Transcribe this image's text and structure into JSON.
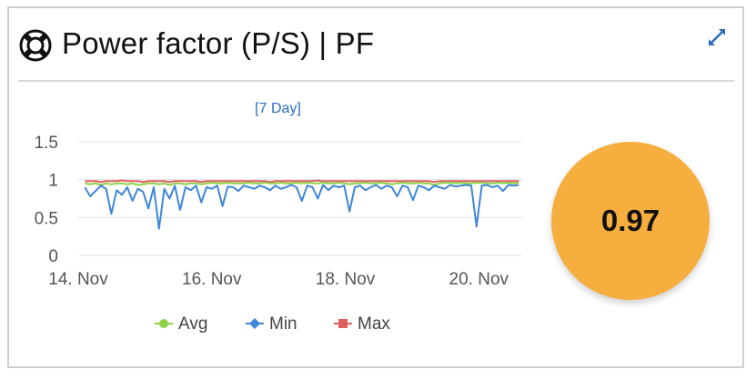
{
  "header": {
    "title": "Power factor (P/S) | PF",
    "icon": "lifebuoy-icon",
    "expand_icon": "expand-icon"
  },
  "chart": {
    "range_label": "[7 Day]",
    "legend": [
      {
        "name": "Avg",
        "color": "#8cd24b",
        "symbol": "circle"
      },
      {
        "name": "Min",
        "color": "#3f86d8",
        "symbol": "diamond"
      },
      {
        "name": "Max",
        "color": "#e06060",
        "symbol": "square"
      }
    ]
  },
  "chart_data": {
    "type": "line",
    "title": "[7 Day]",
    "xlabel": "",
    "ylabel": "",
    "ylim": [
      0,
      1.5
    ],
    "yticks": [
      "0",
      "0.5",
      "1",
      "1.5"
    ],
    "xticks": [
      "14. Nov",
      "16. Nov",
      "18. Nov",
      "20. Nov"
    ],
    "xtick_values": [
      14,
      16,
      18,
      20
    ],
    "xlim": [
      14,
      20.65
    ],
    "grid": true,
    "legend_position": "bottom",
    "series": [
      {
        "name": "Max",
        "color": "#e06060",
        "values": [
          0.98,
          0.98,
          0.98,
          0.97,
          0.98,
          0.98,
          0.98,
          0.99,
          0.98,
          0.98,
          0.98,
          0.97,
          0.98,
          0.98,
          0.98,
          0.98,
          0.97,
          0.98,
          0.98,
          0.98,
          0.98,
          0.98,
          0.97,
          0.98,
          0.98,
          0.98,
          0.98,
          0.98,
          0.98,
          0.98,
          0.98,
          0.98,
          0.98,
          0.98,
          0.98,
          0.97,
          0.98,
          0.98,
          0.98,
          0.98,
          0.98,
          0.98,
          0.98,
          0.98,
          0.99,
          0.98,
          0.98,
          0.98,
          0.98,
          0.98,
          0.98,
          0.98,
          0.98,
          0.98,
          0.98,
          0.98,
          0.98,
          0.98,
          0.98,
          0.98,
          0.98,
          0.98,
          0.98,
          0.98,
          0.98,
          0.98,
          0.97,
          0.98,
          0.98,
          0.98,
          0.98,
          0.98,
          0.98,
          0.98,
          0.98,
          0.98,
          0.98,
          0.98,
          0.98,
          0.98,
          0.98,
          0.98,
          0.98
        ]
      },
      {
        "name": "Avg",
        "color": "#8cd24b",
        "values": [
          0.95,
          0.94,
          0.95,
          0.93,
          0.95,
          0.94,
          0.95,
          0.95,
          0.94,
          0.95,
          0.93,
          0.94,
          0.95,
          0.95,
          0.94,
          0.95,
          0.93,
          0.95,
          0.95,
          0.94,
          0.95,
          0.95,
          0.94,
          0.95,
          0.96,
          0.95,
          0.95,
          0.96,
          0.95,
          0.95,
          0.95,
          0.96,
          0.95,
          0.95,
          0.96,
          0.95,
          0.95,
          0.96,
          0.95,
          0.95,
          0.96,
          0.95,
          0.96,
          0.95,
          0.95,
          0.96,
          0.95,
          0.95,
          0.96,
          0.95,
          0.94,
          0.95,
          0.95,
          0.96,
          0.95,
          0.95,
          0.96,
          0.95,
          0.94,
          0.95,
          0.96,
          0.95,
          0.95,
          0.96,
          0.95,
          0.95,
          0.93,
          0.95,
          0.96,
          0.96,
          0.95,
          0.96,
          0.95,
          0.95,
          0.96,
          0.96,
          0.95,
          0.95,
          0.96,
          0.95,
          0.96,
          0.95,
          0.96
        ]
      },
      {
        "name": "Min",
        "color": "#3f86d8",
        "values": [
          0.9,
          0.78,
          0.85,
          0.92,
          0.88,
          0.55,
          0.86,
          0.8,
          0.9,
          0.72,
          0.88,
          0.84,
          0.62,
          0.9,
          0.35,
          0.88,
          0.75,
          0.92,
          0.6,
          0.9,
          0.86,
          0.92,
          0.7,
          0.9,
          0.88,
          0.92,
          0.65,
          0.91,
          0.9,
          0.85,
          0.92,
          0.9,
          0.88,
          0.92,
          0.9,
          0.86,
          0.92,
          0.88,
          0.9,
          0.93,
          0.9,
          0.72,
          0.92,
          0.9,
          0.75,
          0.93,
          0.86,
          0.92,
          0.9,
          0.92,
          0.58,
          0.9,
          0.92,
          0.86,
          0.9,
          0.93,
          0.88,
          0.92,
          0.9,
          0.78,
          0.92,
          0.9,
          0.73,
          0.92,
          0.9,
          0.86,
          0.92,
          0.9,
          0.88,
          0.93,
          0.91,
          0.92,
          0.93,
          0.92,
          0.38,
          0.92,
          0.93,
          0.9,
          0.92,
          0.85,
          0.93,
          0.92,
          0.93
        ]
      }
    ]
  },
  "gauge": {
    "value": "0.97",
    "color": "#f6ae3f"
  }
}
